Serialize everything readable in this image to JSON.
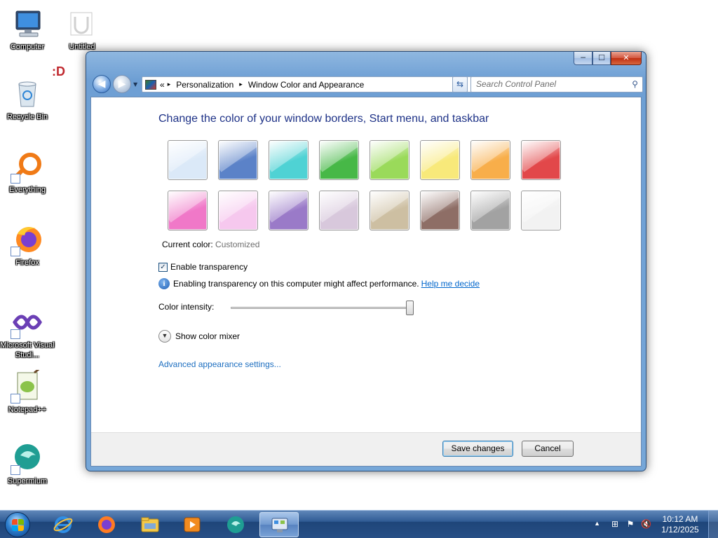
{
  "desktop": {
    "icons": [
      {
        "label": "Computer"
      },
      {
        "label": "Untitled"
      },
      {
        "label": "Recycle Bin"
      },
      {
        "label": "Everything"
      },
      {
        "label": "Firefox"
      },
      {
        "label": "Microsoft Visual Studi..."
      },
      {
        "label": "Notepad++"
      },
      {
        "label": "Supermium"
      }
    ],
    "smiley": ":D"
  },
  "window": {
    "controls": {
      "minimize": "─",
      "maximize": "☐",
      "close": "✕"
    },
    "breadcrumb": {
      "prefix": "«",
      "items": [
        "Personalization",
        "Window Color and Appearance"
      ],
      "separator": "▸"
    },
    "search": {
      "placeholder": "Search Control Panel"
    },
    "heading": "Change the color of your window borders, Start menu, and taskbar",
    "swatches": [
      "#dbe9f8",
      "#5b82c8",
      "#4fd2d4",
      "#47b847",
      "#9ada5a",
      "#f8e97a",
      "#f8ae4a",
      "#e2484a",
      "#f078c8",
      "#f6c8ee",
      "#9a7ac8",
      "#d8c8dc",
      "#cdbfa2",
      "#8e6e66",
      "#a2a2a2",
      "#f2f2f2"
    ],
    "current_color": {
      "label": "Current color:",
      "value": "Customized"
    },
    "transparency": {
      "label": "Enable transparency",
      "checked": true
    },
    "info": {
      "text": "Enabling transparency on this computer might affect performance.",
      "link": "Help me decide"
    },
    "intensity": {
      "label": "Color intensity:",
      "value": 1.0
    },
    "mixer": {
      "label": "Show color mixer"
    },
    "advanced_link": "Advanced appearance settings...",
    "buttons": {
      "save": "Save changes",
      "cancel": "Cancel"
    }
  },
  "taskbar": {
    "apps": [
      "internet-explorer",
      "firefox",
      "file-explorer",
      "media-player",
      "supermium",
      "control-panel"
    ],
    "clock": {
      "time": "10:12 AM",
      "date": "1/12/2025"
    }
  }
}
